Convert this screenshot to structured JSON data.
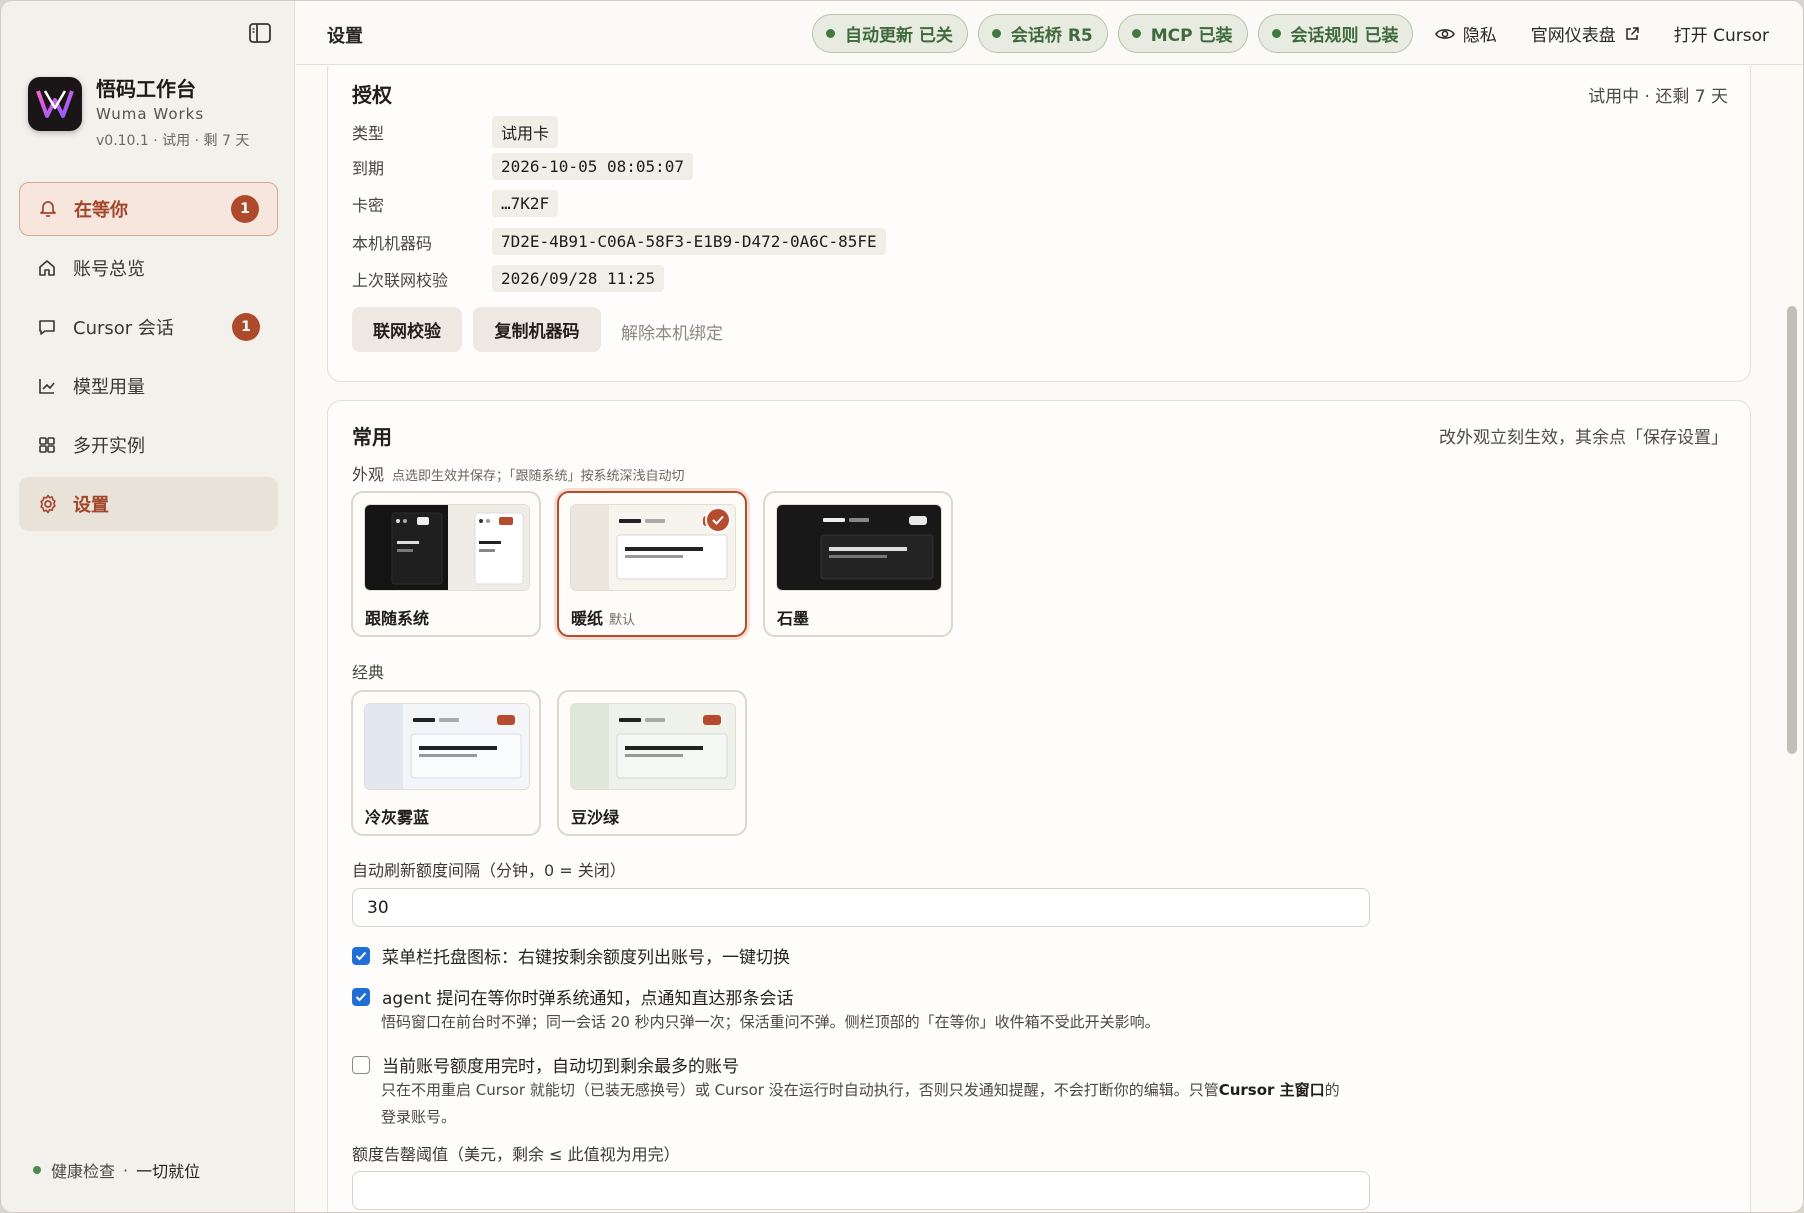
{
  "app": {
    "name": "悟码工作台",
    "subtitle": "Wuma Works",
    "version_line": "v0.10.1 · 试用 · 剩 7 天"
  },
  "sidebar": {
    "items": [
      {
        "label": "在等你",
        "badge": "1",
        "icon": "bell-icon"
      },
      {
        "label": "账号总览",
        "icon": "home-icon"
      },
      {
        "label": "Cursor 会话",
        "badge": "1",
        "icon": "chat-icon"
      },
      {
        "label": "模型用量",
        "icon": "chart-icon"
      },
      {
        "label": "多开实例",
        "icon": "grid-icon"
      },
      {
        "label": "设置",
        "icon": "gear-icon"
      }
    ],
    "health_label": "健康检查",
    "health_sep": "·",
    "health_status": "一切就位"
  },
  "topbar": {
    "title": "设置",
    "pills": [
      "自动更新 已关",
      "会话桥 R5",
      "MCP 已装",
      "会话规则 已装"
    ],
    "privacy": "隐私",
    "dashboard": "官网仪表盘",
    "open_cursor": "打开 Cursor"
  },
  "license": {
    "title": "授权",
    "status": "试用中 · 还剩 7 天",
    "rows": [
      {
        "key": "类型",
        "value": "试用卡"
      },
      {
        "key": "到期",
        "value": "2026-10-05 08:05:07"
      },
      {
        "key": "卡密",
        "value": "…7K2F"
      },
      {
        "key": "本机机器码",
        "value": "7D2E-4B91-C06A-58F3-E1B9-D472-0A6C-85FE"
      },
      {
        "key": "上次联网校验",
        "value": "2026/09/28 11:25"
      }
    ],
    "btn_verify": "联网校验",
    "btn_copy": "复制机器码",
    "btn_unbind": "解除本机绑定"
  },
  "general": {
    "title": "常用",
    "note": "改外观立刻生效，其余点「保存设置」",
    "appearance_label": "外观",
    "appearance_hint": "点选即生效并保存；「跟随系统」按系统深浅自动切",
    "themes": [
      {
        "name": "跟随系统",
        "tag": ""
      },
      {
        "name": "暖纸",
        "tag": "默认",
        "selected": true
      },
      {
        "name": "石墨",
        "tag": ""
      }
    ],
    "classic_label": "经典",
    "classic_themes": [
      {
        "name": "冷灰雾蓝"
      },
      {
        "name": "豆沙绿"
      }
    ],
    "refresh_label": "自动刷新额度间隔（分钟，0 = 关闭）",
    "refresh_value": "30",
    "options": [
      {
        "label": "菜单栏托盘图标：右键按剩余额度列出账号，一键切换",
        "checked": true
      },
      {
        "label": "agent 提问在等你时弹系统通知，点通知直达那条会话",
        "checked": true,
        "help": "悟码窗口在前台时不弹；同一会话 20 秒内只弹一次；保活重问不弹。侧栏顶部的「在等你」收件箱不受此开关影响。"
      },
      {
        "label": "当前账号额度用完时，自动切到剩余最多的账号",
        "checked": false,
        "help_a": "只在不用重启 Cursor 就能切（已装无感换号）或 Cursor 没在运行时自动执行，否则只发通知提醒，不会打断你的编辑。只管",
        "help_b": "Cursor 主窗口",
        "help_c": "的登录账号。"
      }
    ],
    "threshold_label": "额度告罄阈值（美元，剩余 ≤ 此值视为用完）"
  },
  "colors": {
    "accent": "#b54c2e",
    "pill_green": "#3f6a3c",
    "checkbox_blue": "#1f6fd6"
  }
}
